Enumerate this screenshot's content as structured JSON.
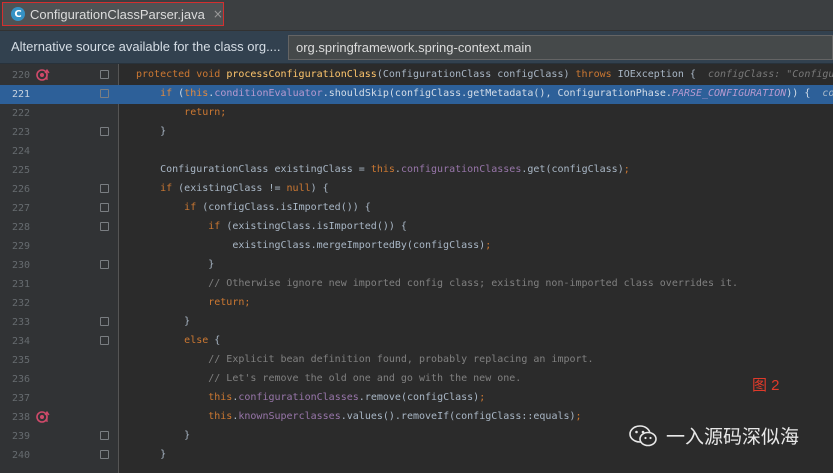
{
  "tab": {
    "icon": "C",
    "label": "ConfigurationClassParser.java",
    "close": "×"
  },
  "notice": {
    "text": "Alternative source available for the class org....",
    "selected_source": "org.springframework.spring-context.main"
  },
  "lines": [
    {
      "num": "220",
      "segs": [
        {
          "t": "protected void ",
          "c": "kw"
        },
        {
          "t": "processConfigurationClass",
          "c": "fn"
        },
        {
          "t": "(ConfigurationClass configClass) "
        },
        {
          "t": "throws ",
          "c": "kw"
        },
        {
          "t": "IOException {  "
        },
        {
          "t": "configClass: \"Configu",
          "c": "hint"
        }
      ]
    },
    {
      "num": "221",
      "segs": [
        {
          "t": "    "
        },
        {
          "t": "if ",
          "c": "kw"
        },
        {
          "t": "("
        },
        {
          "t": "this",
          "c": "kw"
        },
        {
          "t": "."
        },
        {
          "t": "conditionEvaluator",
          "c": "fld"
        },
        {
          "t": ".shouldSkip(configClass.getMetadata(), ConfigurationPhase."
        },
        {
          "t": "PARSE_CONFIGURATION",
          "c": "fld it"
        },
        {
          "t": ")) {  "
        },
        {
          "t": "co",
          "c": "hint"
        }
      ]
    },
    {
      "num": "222",
      "segs": [
        {
          "t": "        "
        },
        {
          "t": "return",
          "c": "kw"
        },
        {
          "t": ";",
          "c": "kw"
        }
      ]
    },
    {
      "num": "223",
      "segs": [
        {
          "t": "    }"
        }
      ]
    },
    {
      "num": "224",
      "segs": []
    },
    {
      "num": "225",
      "segs": [
        {
          "t": "    ConfigurationClass existingClass = "
        },
        {
          "t": "this",
          "c": "kw"
        },
        {
          "t": "."
        },
        {
          "t": "configurationClasses",
          "c": "fld"
        },
        {
          "t": ".get(configClass)"
        },
        {
          "t": ";",
          "c": "kw"
        }
      ]
    },
    {
      "num": "226",
      "segs": [
        {
          "t": "    "
        },
        {
          "t": "if ",
          "c": "kw"
        },
        {
          "t": "(existingClass != "
        },
        {
          "t": "null",
          "c": "kw"
        },
        {
          "t": ") {"
        }
      ]
    },
    {
      "num": "227",
      "segs": [
        {
          "t": "        "
        },
        {
          "t": "if ",
          "c": "kw"
        },
        {
          "t": "(configClass.isImported()) {"
        }
      ]
    },
    {
      "num": "228",
      "segs": [
        {
          "t": "            "
        },
        {
          "t": "if ",
          "c": "kw"
        },
        {
          "t": "(existingClass.isImported()) {"
        }
      ]
    },
    {
      "num": "229",
      "segs": [
        {
          "t": "                existingClass.mergeImportedBy(configClass)"
        },
        {
          "t": ";",
          "c": "kw"
        }
      ]
    },
    {
      "num": "230",
      "segs": [
        {
          "t": "            }"
        }
      ]
    },
    {
      "num": "231",
      "segs": [
        {
          "t": "            "
        },
        {
          "t": "// Otherwise ignore new imported config class; existing non-imported class overrides it.",
          "c": "cm"
        }
      ]
    },
    {
      "num": "232",
      "segs": [
        {
          "t": "            "
        },
        {
          "t": "return",
          "c": "kw"
        },
        {
          "t": ";",
          "c": "kw"
        }
      ]
    },
    {
      "num": "233",
      "segs": [
        {
          "t": "        }"
        }
      ]
    },
    {
      "num": "234",
      "segs": [
        {
          "t": "        "
        },
        {
          "t": "else ",
          "c": "kw"
        },
        {
          "t": "{"
        }
      ]
    },
    {
      "num": "235",
      "segs": [
        {
          "t": "            "
        },
        {
          "t": "// Explicit bean definition found, probably replacing an import.",
          "c": "cm"
        }
      ]
    },
    {
      "num": "236",
      "segs": [
        {
          "t": "            "
        },
        {
          "t": "// Let's remove the old one and go with the new one.",
          "c": "cm"
        }
      ]
    },
    {
      "num": "237",
      "segs": [
        {
          "t": "            "
        },
        {
          "t": "this",
          "c": "kw"
        },
        {
          "t": "."
        },
        {
          "t": "configurationClasses",
          "c": "fld"
        },
        {
          "t": ".remove(configClass)"
        },
        {
          "t": ";",
          "c": "kw"
        }
      ]
    },
    {
      "num": "238",
      "segs": [
        {
          "t": "            "
        },
        {
          "t": "this",
          "c": "kw"
        },
        {
          "t": "."
        },
        {
          "t": "knownSuperclasses",
          "c": "fld"
        },
        {
          "t": ".values().removeIf(configClass::equals)"
        },
        {
          "t": ";",
          "c": "kw"
        }
      ]
    },
    {
      "num": "239",
      "segs": [
        {
          "t": "        }"
        }
      ]
    },
    {
      "num": "240",
      "segs": [
        {
          "t": "    }"
        }
      ]
    }
  ],
  "highlight_line": "221",
  "fold_lines": [
    "220",
    "221",
    "223",
    "226",
    "227",
    "228",
    "230",
    "233",
    "234",
    "239",
    "240"
  ],
  "markers": [
    {
      "line": "220",
      "icon": "breakpoint-override-icon",
      "color": "#d04a6a"
    },
    {
      "line": "238",
      "icon": "implements-marker-icon",
      "color": "#d04a6a"
    }
  ],
  "figure_label": "图 2",
  "watermark": {
    "logo_icon": "wechat-icon",
    "text": "一入源码深似海"
  },
  "colors": {
    "keyword": "#cc7832",
    "field": "#9876aa",
    "method": "#ffc66d",
    "comment": "#808080",
    "selection": "#2d6099",
    "tab_border": "#d32f2f"
  }
}
